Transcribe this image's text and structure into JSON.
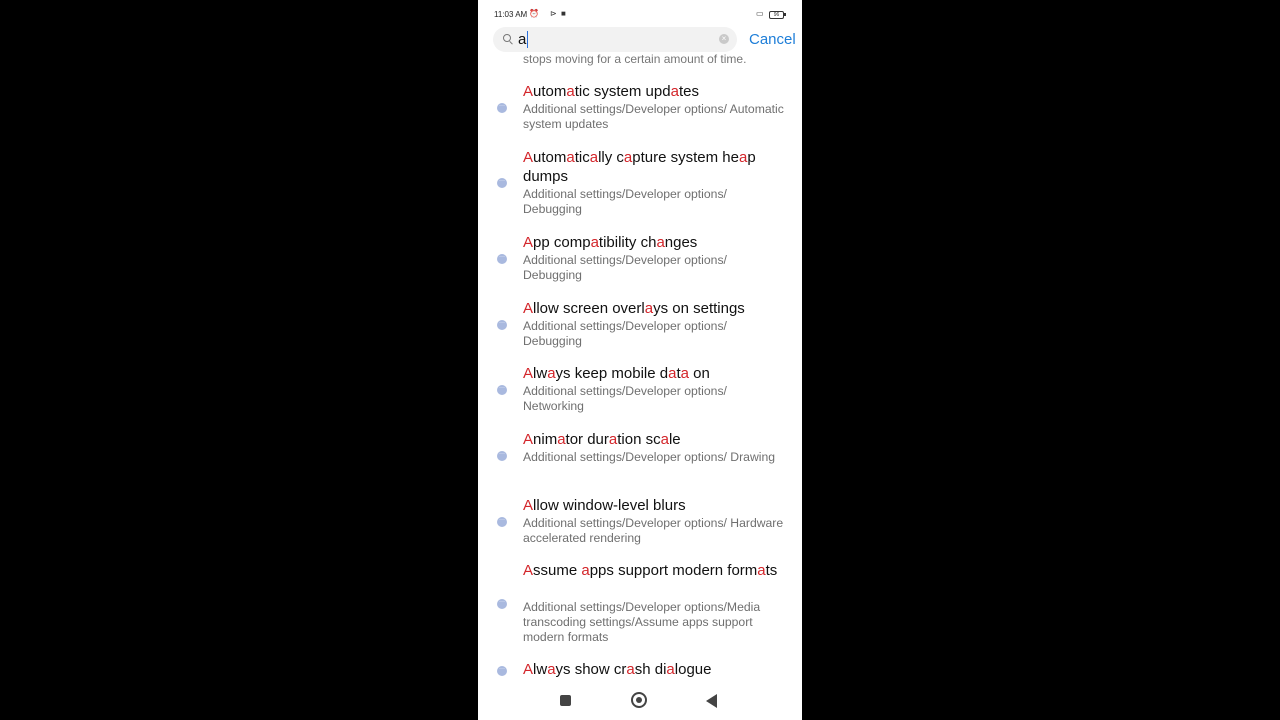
{
  "status_bar": {
    "time": "11:03 AM",
    "battery": "96"
  },
  "search": {
    "query": "a",
    "cancel_label": "Cancel"
  },
  "partial_item_text": "stops moving for a certain amount of time.",
  "results": [
    {
      "title_parts": [
        [
          "A",
          1
        ],
        [
          "utom",
          0
        ],
        [
          "a",
          1
        ],
        [
          "tic system upd",
          0
        ],
        [
          "a",
          1
        ],
        [
          "tes",
          0
        ]
      ],
      "subtitle": "Additional settings/Developer options/ Automatic system updates"
    },
    {
      "title_parts": [
        [
          "A",
          1
        ],
        [
          "utom",
          0
        ],
        [
          "a",
          1
        ],
        [
          "tic",
          0
        ],
        [
          "a",
          1
        ],
        [
          "lly c",
          0
        ],
        [
          "a",
          1
        ],
        [
          "pture system he",
          0
        ],
        [
          "a",
          1
        ],
        [
          "p dumps",
          0
        ]
      ],
      "subtitle": "Additional settings/Developer options/ Debugging"
    },
    {
      "title_parts": [
        [
          "A",
          1
        ],
        [
          "pp comp",
          0
        ],
        [
          "a",
          1
        ],
        [
          "tibility ch",
          0
        ],
        [
          "a",
          1
        ],
        [
          "nges",
          0
        ]
      ],
      "subtitle": "Additional settings/Developer options/ Debugging"
    },
    {
      "title_parts": [
        [
          "A",
          1
        ],
        [
          "llow screen overl",
          0
        ],
        [
          "a",
          1
        ],
        [
          "ys on settings",
          0
        ]
      ],
      "subtitle": "Additional settings/Developer options/ Debugging"
    },
    {
      "title_parts": [
        [
          "A",
          1
        ],
        [
          "lw",
          0
        ],
        [
          "a",
          1
        ],
        [
          "ys keep mobile d",
          0
        ],
        [
          "a",
          1
        ],
        [
          "t",
          0
        ],
        [
          "a",
          1
        ],
        [
          " on",
          0
        ]
      ],
      "subtitle": "Additional settings/Developer options/ Networking"
    },
    {
      "title_parts": [
        [
          "A",
          1
        ],
        [
          "nim",
          0
        ],
        [
          "a",
          1
        ],
        [
          "tor dur",
          0
        ],
        [
          "a",
          1
        ],
        [
          "tion sc",
          0
        ],
        [
          "a",
          1
        ],
        [
          "le",
          0
        ]
      ],
      "subtitle": "Additional settings/Developer options/ Drawing"
    },
    {
      "title_parts": [
        [
          "A",
          1
        ],
        [
          "llow window-level blurs",
          0
        ]
      ],
      "subtitle": "Additional settings/Developer options/ Hardware accelerated rendering"
    },
    {
      "title_parts": [
        [
          "A",
          1
        ],
        [
          "ssume ",
          0
        ],
        [
          "a",
          1
        ],
        [
          "pps support modern form",
          0
        ],
        [
          "a",
          1
        ],
        [
          "ts",
          0
        ]
      ],
      "subtitle": "Additional settings/Developer options/Media transcoding settings/Assume apps support modern formats"
    },
    {
      "title_parts": [
        [
          "A",
          1
        ],
        [
          "lw",
          0
        ],
        [
          "a",
          1
        ],
        [
          "ys show cr",
          0
        ],
        [
          "a",
          1
        ],
        [
          "sh di",
          0
        ],
        [
          "a",
          1
        ],
        [
          "logue",
          0
        ]
      ],
      "subtitle": ""
    }
  ]
}
